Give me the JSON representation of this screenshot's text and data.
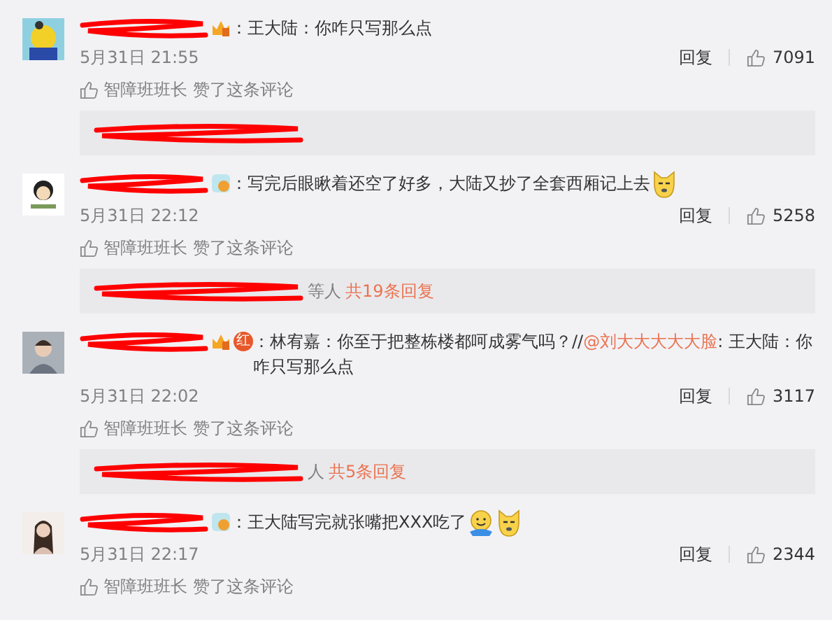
{
  "comments": [
    {
      "badges": [
        {
          "kind": "crown"
        }
      ],
      "parts": [
        {
          "kind": "plain",
          "text": "：王大陆：你咋只写那么点"
        }
      ],
      "time": "5月31日 21:55",
      "reply": "回复",
      "likes": "7091",
      "liked_by": "智障班班长",
      "liked_note": "赞了这条评论",
      "replies_bar": true
    },
    {
      "badges": [
        {
          "kind": "round"
        }
      ],
      "parts": [
        {
          "kind": "plain",
          "text": "：写完后眼瞅着还空了好多，大陆又抄了全套西厢记上去"
        }
      ],
      "emojis": [
        {
          "kind": "dog"
        }
      ],
      "time": "5月31日 22:12",
      "reply": "回复",
      "likes": "5258",
      "liked_by": "智障班班长",
      "liked_note": "赞了这条评论",
      "replies_bar": true,
      "replies": {
        "people": "等人",
        "count": "共19条回复"
      }
    },
    {
      "badges": [
        {
          "kind": "crown"
        },
        {
          "kind": "label",
          "text": "红"
        }
      ],
      "parts": [
        {
          "kind": "plain",
          "text": "：林宥嘉：你至于把整栋楼都呵成雾气吗？//"
        },
        {
          "kind": "mention",
          "text": "@刘大大大大大脸"
        },
        {
          "kind": "plain",
          "text": ": 王大陆：你咋只写那么点"
        }
      ],
      "time": "5月31日 22:02",
      "reply": "回复",
      "likes": "3117",
      "liked_by": "智障班班长",
      "liked_note": "赞了这条评论",
      "replies_bar": true,
      "replies": {
        "people": "人",
        "count": "共5条回复"
      }
    },
    {
      "badges": [
        {
          "kind": "round"
        }
      ],
      "parts": [
        {
          "kind": "plain",
          "text": "：王大陆写完就张嘴把XXX吃了"
        }
      ],
      "emojis": [
        {
          "kind": "hug"
        },
        {
          "kind": "dog"
        }
      ],
      "time": "5月31日 22:17",
      "reply": "回复",
      "likes": "2344",
      "liked_by": "智障班班长",
      "liked_note": "赞了这条评论"
    }
  ]
}
